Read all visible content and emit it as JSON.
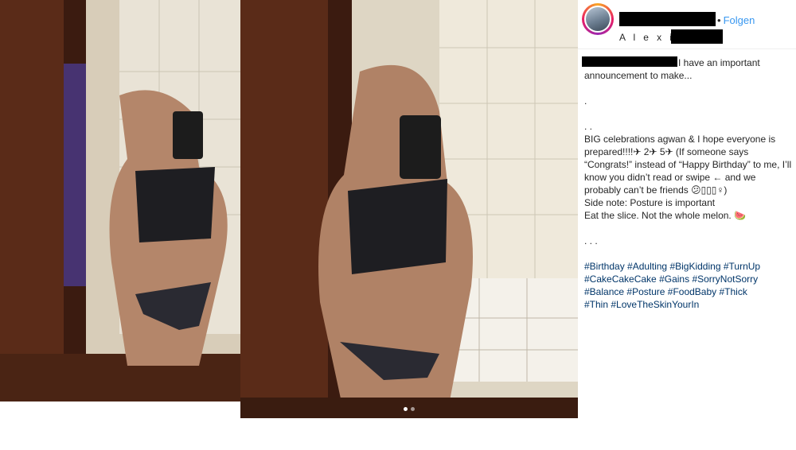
{
  "header": {
    "follow_separator": "•",
    "follow_label": "Folgen",
    "location_visible": "A l e x i s R"
  },
  "caption": {
    "line1": "I have an important announcement to make...",
    "dot1": ".",
    "dot2": ". .",
    "para1": "BIG celebrations agwan & I hope everyone is prepared!!!!✈ 2✈ 5✈ (If someone says “Congrats!” instead of “Happy Birthday” to me, I’ll know you didn’t read or swipe ← and we probably can’t be friends 😕▯▯▯♀)",
    "para2": "Side note: Posture is important",
    "para3": "Eat the slice. Not the whole melon. 🍉",
    "dot3": ". . .",
    "hashtags": [
      "#Birthday",
      "#Adulting",
      "#BigKidding",
      "#TurnUp",
      "#CakeCakeCake",
      "#Gains",
      "#SorryNotSorry",
      "#Balance",
      "#Posture",
      "#FoodBaby",
      "#Thick",
      "#Thin",
      "#LoveTheSkinYourIn"
    ]
  },
  "carousel": {
    "slides": 2,
    "photo1_active_index": 1,
    "photo2_active_index": 0
  },
  "colors": {
    "link": "#3897f0",
    "hashtag": "#003569",
    "text": "#262626",
    "redaction": "#000000"
  }
}
